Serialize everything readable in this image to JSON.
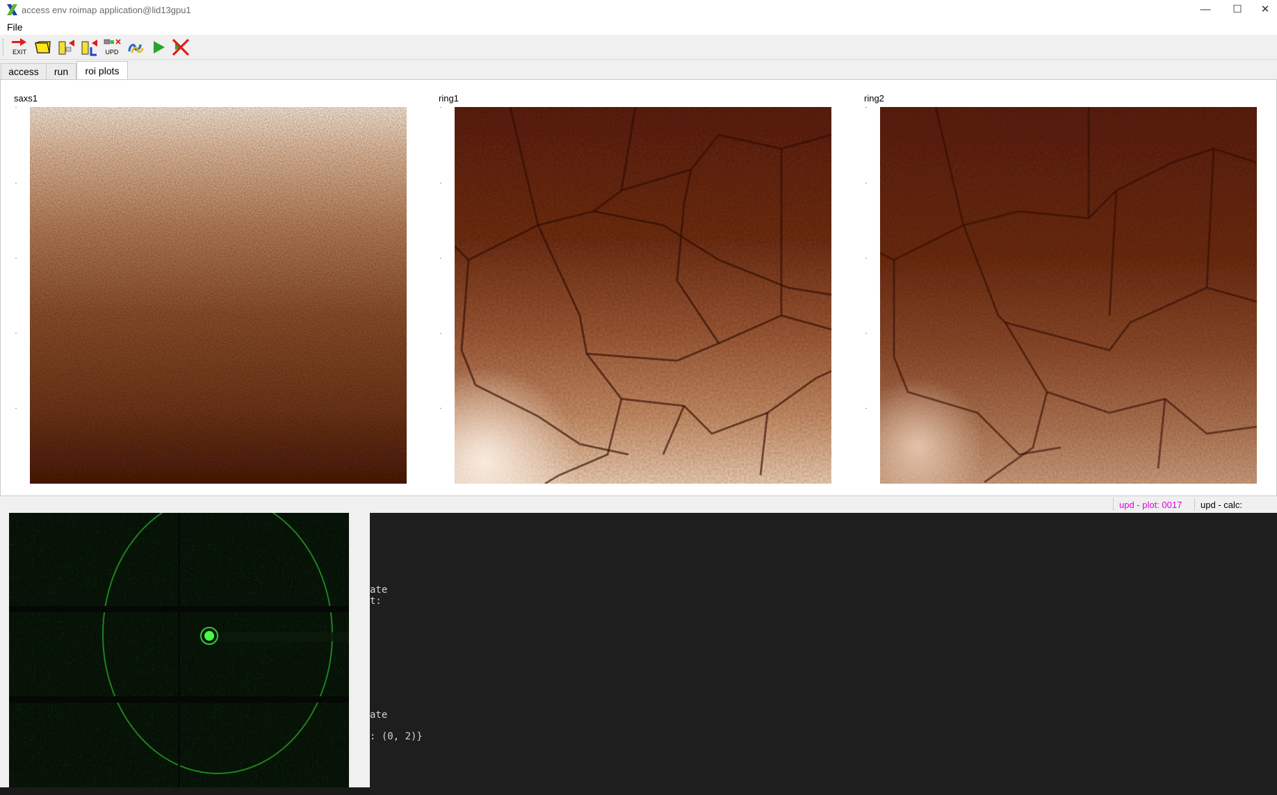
{
  "window": {
    "title": "access env roimap application@lid13gpu1",
    "minimize_glyph": "—",
    "maximize_glyph": "☐",
    "close_glyph": "✕"
  },
  "menubar": {
    "file_label": "File"
  },
  "toolbar": {
    "exit_label": "EXIT",
    "upd_label": "UPD",
    "icons": [
      "exit-icon",
      "open-folder-icon",
      "load-roi-icon",
      "load-l-icon",
      "upd-icon",
      "snake-icon",
      "run-icon",
      "stop-icon"
    ]
  },
  "tabs": [
    {
      "label": "access"
    },
    {
      "label": "run"
    },
    {
      "label": "roi plots",
      "active": true
    }
  ],
  "plots": [
    {
      "label": "saxs1"
    },
    {
      "label": "ring1"
    },
    {
      "label": "ring2"
    }
  ],
  "status": {
    "plot": "upd - plot: 0017",
    "calc": "upd - calc:",
    "plot_color": "#e000e0"
  },
  "terminal": {
    "lines": [
      "ate",
      "t:",
      "ate",
      ": (0, 2)}"
    ]
  },
  "colors": {
    "heatmap_dark": "#3a0e00",
    "heatmap_light": "#f3dfcf",
    "detector_green": "#22d022"
  }
}
